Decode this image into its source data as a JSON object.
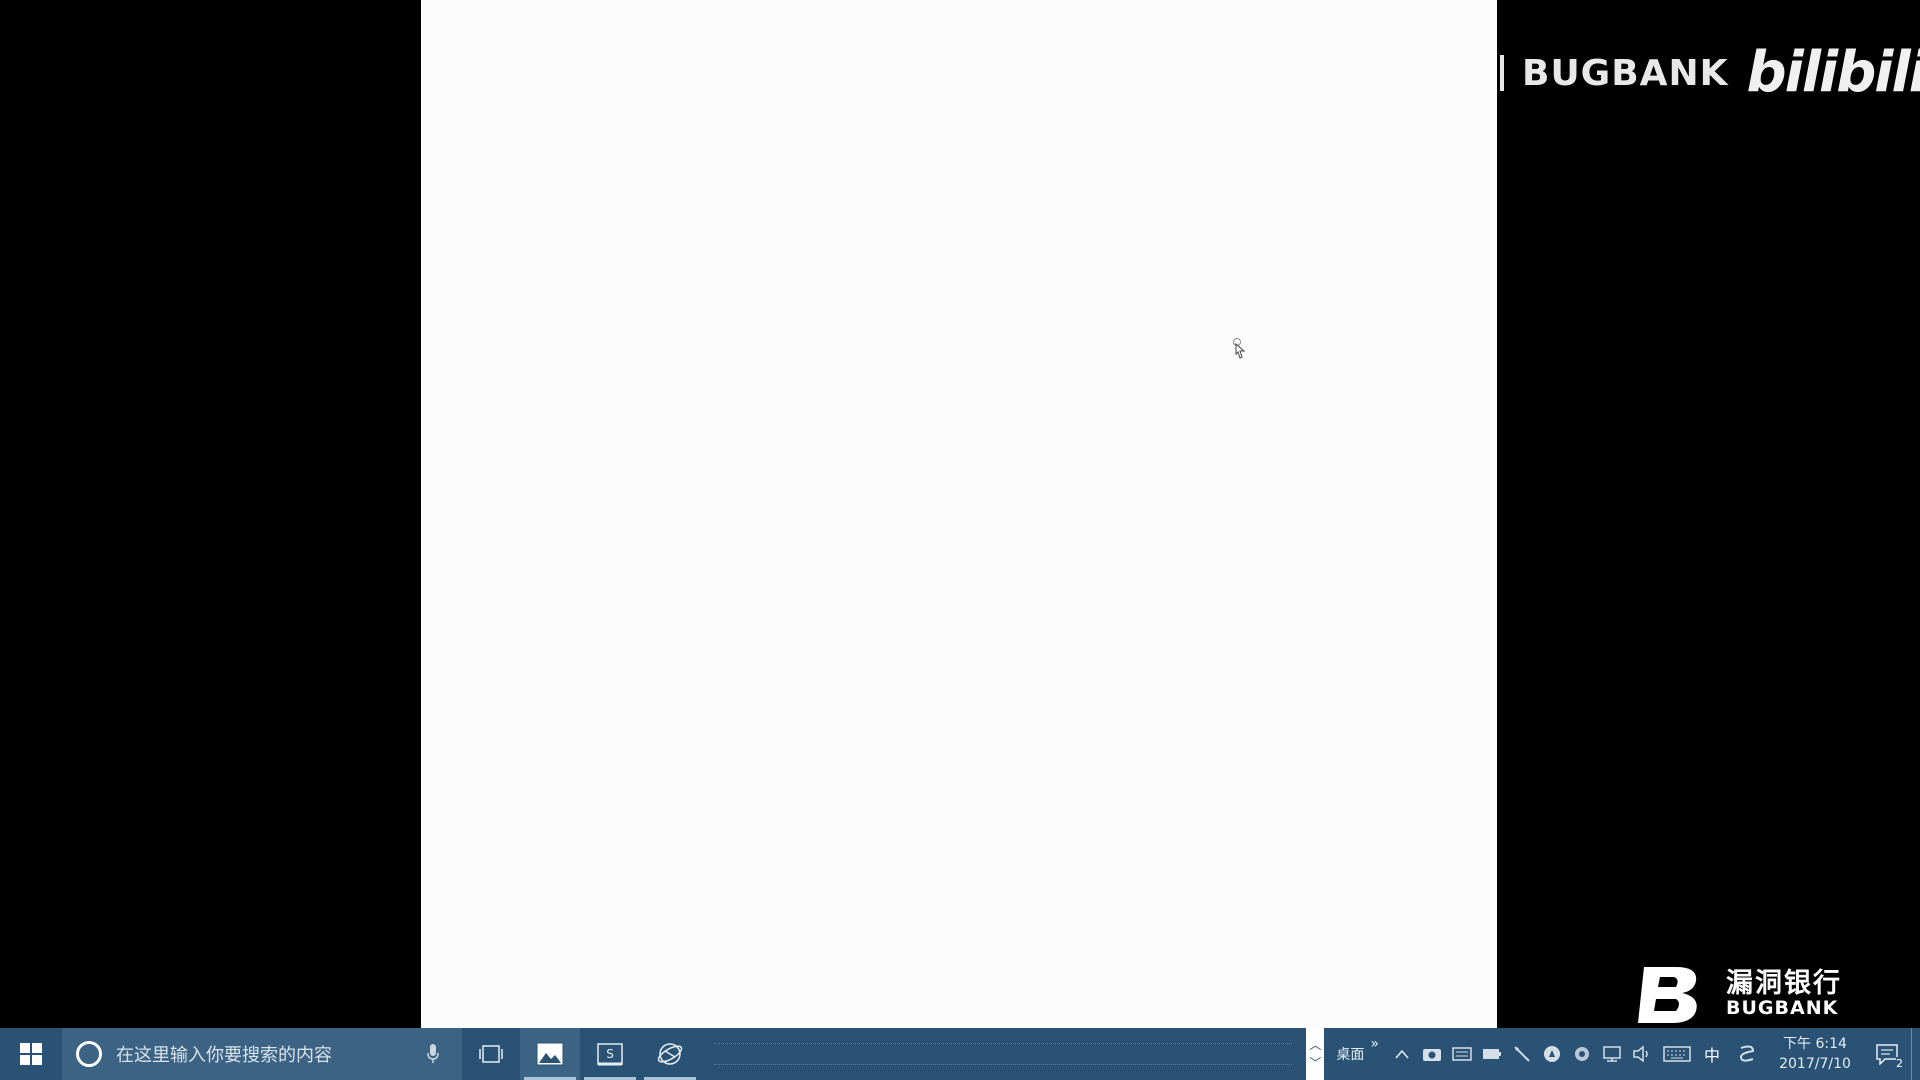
{
  "watermark_top": {
    "brand": "BUGBANK",
    "platform": "bilibili"
  },
  "watermark_bottom": {
    "name_cn": "漏洞银行",
    "name_en": "BUGBANK"
  },
  "taskbar": {
    "search_placeholder": "在这里输入你要搜索的内容",
    "desktop_toolbar_label": "桌面",
    "desktop_toolbar_chevron": "»",
    "ime_label": "中",
    "clock_time": "下午 6:14",
    "clock_date": "2017/7/10",
    "notification_count": "2",
    "apps": [
      {
        "name": "photos-app",
        "icon": "image-icon",
        "active": true
      },
      {
        "name": "sublime-app",
        "icon": "editor-icon",
        "active": false
      },
      {
        "name": "browser-app",
        "icon": "globe-icon",
        "active": false
      }
    ]
  },
  "colors": {
    "taskbar_bg": "#2a5274",
    "search_bg": "#3c6384",
    "canvas_bg": "#fbfcfb",
    "screen_bg": "#000000"
  }
}
